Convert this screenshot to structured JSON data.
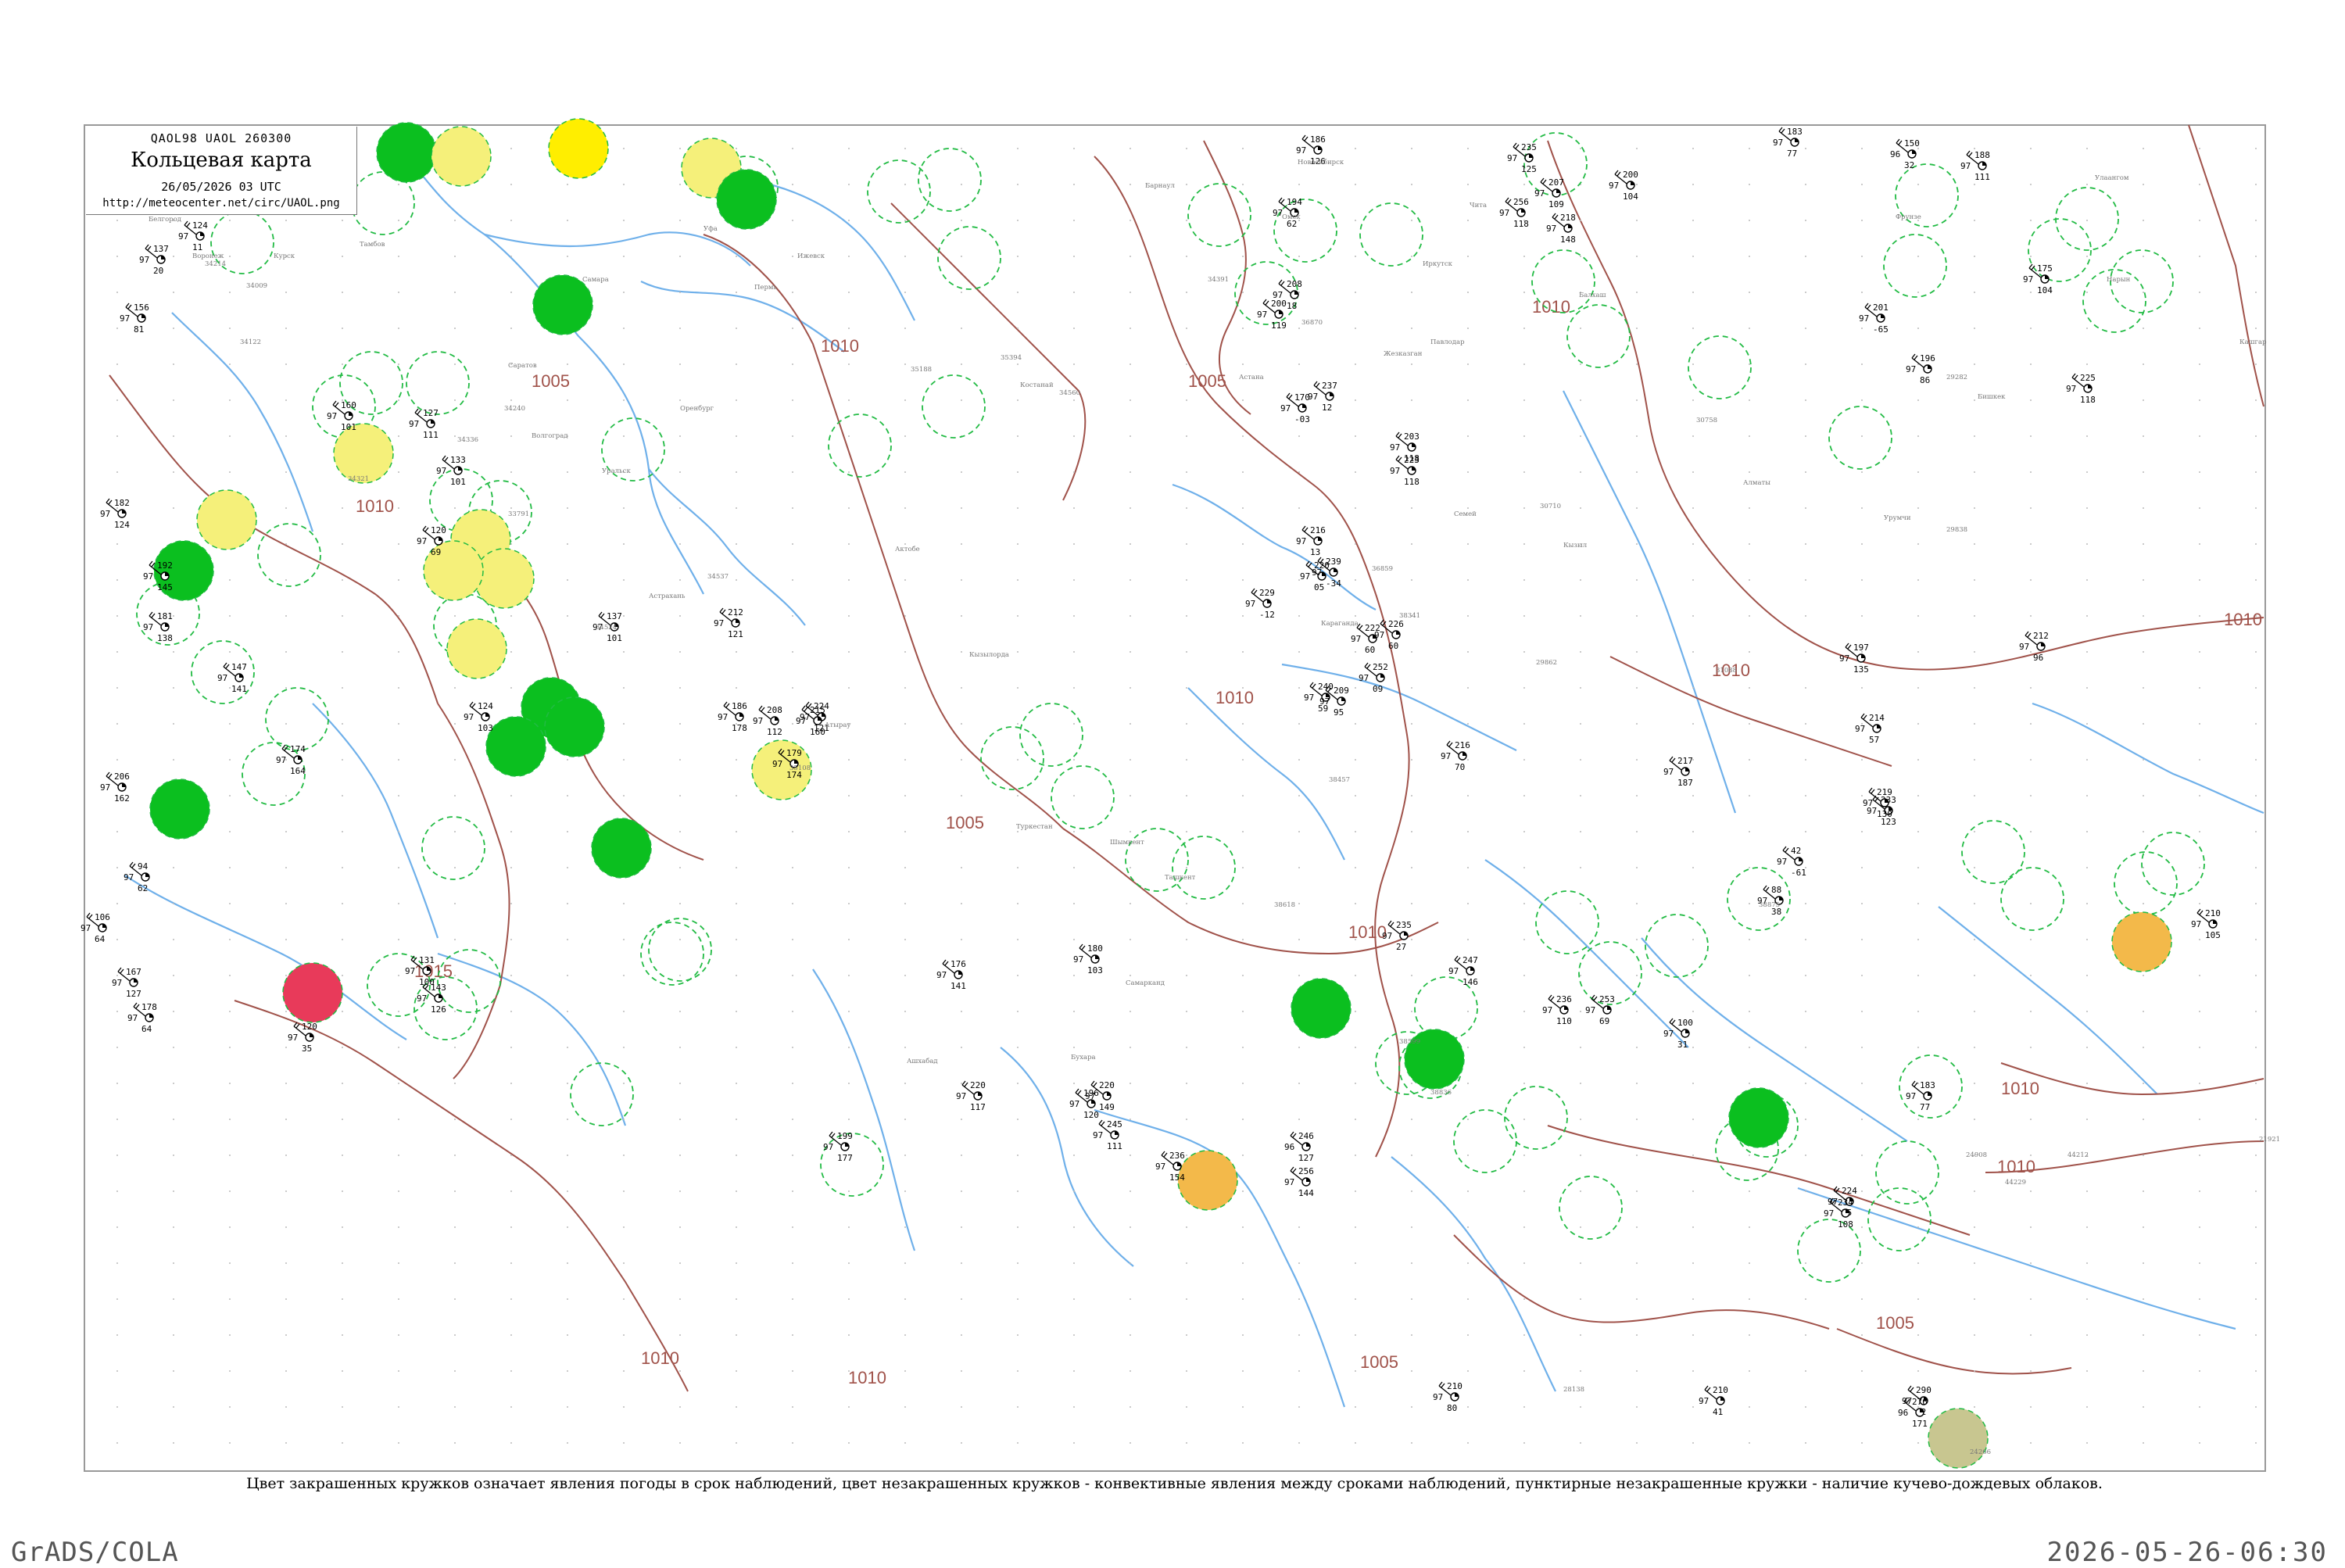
{
  "header": {
    "codes": "QAOL98  UAOL  260300",
    "title": "Кольцевая карта",
    "date": "26/05/2026 03 UTC",
    "url": "http://meteocenter.net/circ/UAOL.png"
  },
  "caption": "Цвет закрашенных кружков означает явления погоды в срок наблюдений, цвет незакрашенных кружков - конвективные явления между сроками наблюдений, пунктирные незакрашенные кружки - наличие кучево-дождевых облаков.",
  "footer": {
    "left": "GrADS/COLA",
    "right": "2026-05-26-06:30"
  },
  "map": {
    "isobar_labels": [
      "1010",
      "1005",
      "1010",
      "1015",
      "1005",
      "1010",
      "1010",
      "1005",
      "1010",
      "1010",
      "1005",
      "1010",
      "1010",
      "1010",
      "1010",
      "1005",
      "1010"
    ],
    "colors": {
      "river": "#6fb0ea",
      "isobar": "#a0524a",
      "frame": "#999999",
      "green_fill": "#0bbf1f",
      "yellow_fill": "#f5f07a",
      "bright_yellow": "#ffee00",
      "orange_fill": "#f3b94a",
      "red_fill": "#e83a5a",
      "olive_fill": "#c8c690",
      "dashed_circle": "#22bb44"
    },
    "stations": [
      {
        "top": "137",
        "left": "97",
        "bottom": "20"
      },
      {
        "top": "124",
        "left": "97",
        "bottom": "11"
      },
      {
        "top": "156",
        "left": "97",
        "bottom": "81"
      },
      {
        "top": "182",
        "left": "97",
        "bottom": "124"
      },
      {
        "top": "192",
        "left": "97",
        "bottom": "145"
      },
      {
        "top": "181",
        "left": "97",
        "bottom": "138"
      },
      {
        "top": "174",
        "left": "97",
        "bottom": "164"
      },
      {
        "top": "206",
        "left": "97",
        "bottom": "162"
      },
      {
        "top": "147",
        "left": "97",
        "bottom": "141"
      },
      {
        "top": "94",
        "left": "97",
        "bottom": "62"
      },
      {
        "top": "106",
        "left": "97",
        "bottom": "64"
      },
      {
        "top": "167",
        "left": "97",
        "bottom": "127"
      },
      {
        "top": "178",
        "left": "97",
        "bottom": "64"
      },
      {
        "top": "120",
        "left": "97",
        "bottom": "35"
      },
      {
        "top": "131",
        "left": "97",
        "bottom": "100"
      },
      {
        "top": "143",
        "left": "97",
        "bottom": "126"
      },
      {
        "top": "160",
        "left": "97",
        "bottom": "101"
      },
      {
        "top": "127",
        "left": "97",
        "bottom": "111"
      },
      {
        "top": "133",
        "left": "97",
        "bottom": "101"
      },
      {
        "top": "120",
        "left": "97",
        "bottom": "69"
      },
      {
        "top": "124",
        "left": "97",
        "bottom": "103"
      },
      {
        "top": "137",
        "left": "97",
        "bottom": "101"
      },
      {
        "top": "212",
        "left": "97",
        "bottom": "121"
      },
      {
        "top": "208",
        "left": "97",
        "bottom": "112"
      },
      {
        "top": "224",
        "left": "97",
        "bottom": "121"
      },
      {
        "top": "186",
        "left": "97",
        "bottom": "178"
      },
      {
        "top": "215",
        "left": "97",
        "bottom": "160"
      },
      {
        "top": "179",
        "left": "97",
        "bottom": "174"
      },
      {
        "top": "176",
        "left": "97",
        "bottom": "141"
      },
      {
        "top": "180",
        "left": "97",
        "bottom": "103"
      },
      {
        "top": "220",
        "left": "97",
        "bottom": "117"
      },
      {
        "top": "199",
        "left": "97",
        "bottom": "177"
      },
      {
        "top": "196",
        "left": "97",
        "bottom": "120"
      },
      {
        "top": "245",
        "left": "97",
        "bottom": "111"
      },
      {
        "top": "220",
        "left": "97",
        "bottom": "149"
      },
      {
        "top": "236",
        "left": "97",
        "bottom": "154"
      },
      {
        "top": "256",
        "left": "97",
        "bottom": "144"
      },
      {
        "top": "246",
        "left": "96",
        "bottom": "127"
      },
      {
        "top": "210",
        "left": "97",
        "bottom": "80"
      },
      {
        "top": "183",
        "left": "97",
        "bottom": "77"
      },
      {
        "top": "210",
        "left": "97",
        "bottom": "41"
      },
      {
        "top": "290",
        "left": "97",
        "bottom": "92"
      },
      {
        "top": "276",
        "left": "96",
        "bottom": "171"
      },
      {
        "top": "186",
        "left": "97",
        "bottom": "126"
      },
      {
        "top": "194",
        "left": "97",
        "bottom": "62"
      },
      {
        "top": "208",
        "left": "97",
        "bottom": "18"
      },
      {
        "top": "200",
        "left": "97",
        "bottom": "119"
      },
      {
        "top": "170",
        "left": "97",
        "bottom": "-03"
      },
      {
        "top": "237",
        "left": "97",
        "bottom": "12"
      },
      {
        "top": "223",
        "left": "97",
        "bottom": "118"
      },
      {
        "top": "203",
        "left": "97",
        "bottom": "118"
      },
      {
        "top": "216",
        "left": "97",
        "bottom": "13"
      },
      {
        "top": "220",
        "left": "97",
        "bottom": "05"
      },
      {
        "top": "239",
        "left": "97",
        "bottom": "-34"
      },
      {
        "top": "229",
        "left": "97",
        "bottom": "-12"
      },
      {
        "top": "222",
        "left": "97",
        "bottom": "60"
      },
      {
        "top": "226",
        "left": "97",
        "bottom": "60"
      },
      {
        "top": "252",
        "left": "97",
        "bottom": "09"
      },
      {
        "top": "240",
        "left": "97",
        "bottom": "59"
      },
      {
        "top": "209",
        "left": "97",
        "bottom": "95"
      },
      {
        "top": "216",
        "left": "97",
        "bottom": "70"
      },
      {
        "top": "235",
        "left": "97",
        "bottom": "27"
      },
      {
        "top": "247",
        "left": "97",
        "bottom": "146"
      },
      {
        "top": "236",
        "left": "97",
        "bottom": "110"
      },
      {
        "top": "253",
        "left": "97",
        "bottom": "69"
      },
      {
        "top": "235",
        "left": "97",
        "bottom": "125"
      },
      {
        "top": "256",
        "left": "97",
        "bottom": "118"
      },
      {
        "top": "218",
        "left": "97",
        "bottom": "148"
      },
      {
        "top": "207",
        "left": "97",
        "bottom": "109"
      },
      {
        "top": "200",
        "left": "97",
        "bottom": "104"
      },
      {
        "top": "183",
        "left": "97",
        "bottom": "77"
      },
      {
        "top": "150",
        "left": "96",
        "bottom": "32"
      },
      {
        "top": "188",
        "left": "97",
        "bottom": "111"
      },
      {
        "top": "175",
        "left": "97",
        "bottom": "104"
      },
      {
        "top": "196",
        "left": "97",
        "bottom": "86"
      },
      {
        "top": "201",
        "left": "97",
        "bottom": "-65"
      },
      {
        "top": "225",
        "left": "97",
        "bottom": "118"
      },
      {
        "top": "210",
        "left": "97",
        "bottom": "105"
      },
      {
        "top": "233",
        "left": "97",
        "bottom": "123"
      },
      {
        "top": "219",
        "left": "97",
        "bottom": "130"
      },
      {
        "top": "197",
        "left": "97",
        "bottom": "135"
      },
      {
        "top": "212",
        "left": "97",
        "bottom": "96"
      },
      {
        "top": "214",
        "left": "97",
        "bottom": "57"
      },
      {
        "top": "224",
        "left": "97",
        "bottom": "35"
      },
      {
        "top": "234",
        "left": "97",
        "bottom": "108"
      },
      {
        "top": "217",
        "left": "97",
        "bottom": "187"
      },
      {
        "top": "88",
        "left": "97",
        "bottom": "38"
      },
      {
        "top": "100",
        "left": "97",
        "bottom": "31"
      },
      {
        "top": "42",
        "left": "97",
        "bottom": "-61"
      }
    ],
    "station_ids": [
      "34214",
      "34009",
      "34122",
      "34321",
      "34336",
      "34240",
      "33791",
      "34524",
      "34537",
      "35108",
      "35188",
      "35394",
      "34560",
      "34391",
      "36870",
      "36859",
      "38341",
      "38457",
      "38618",
      "38599",
      "38836",
      "38875",
      "29282",
      "29838",
      "29862",
      "30710",
      "30758",
      "31088",
      "44212",
      "44229",
      "24908",
      "28138",
      "24266",
      "21921"
    ],
    "place_names": [
      "Белгород",
      "Воронеж",
      "Курск",
      "Тамбов",
      "Волгоград",
      "Астрахань",
      "Саратов",
      "Самара",
      "Оренбург",
      "Уфа",
      "Пермь",
      "Ижевск",
      "Уральск",
      "Актобе",
      "Атырау",
      "Костанай",
      "Кызылорда",
      "Туркестан",
      "Шымкент",
      "Ташкент",
      "Самарканд",
      "Бухара",
      "Ашхабад",
      "Барнаул",
      "Новосибирск",
      "Омск",
      "Павлодар",
      "Семей",
      "Караганда",
      "Астана",
      "Жезказган",
      "Балхаш",
      "Алматы",
      "Бишкек",
      "Фрунзе",
      "Нарын",
      "Кашгар",
      "Урумчи",
      "Улаангом",
      "Кызыл",
      "Иркутск",
      "Чита"
    ]
  }
}
